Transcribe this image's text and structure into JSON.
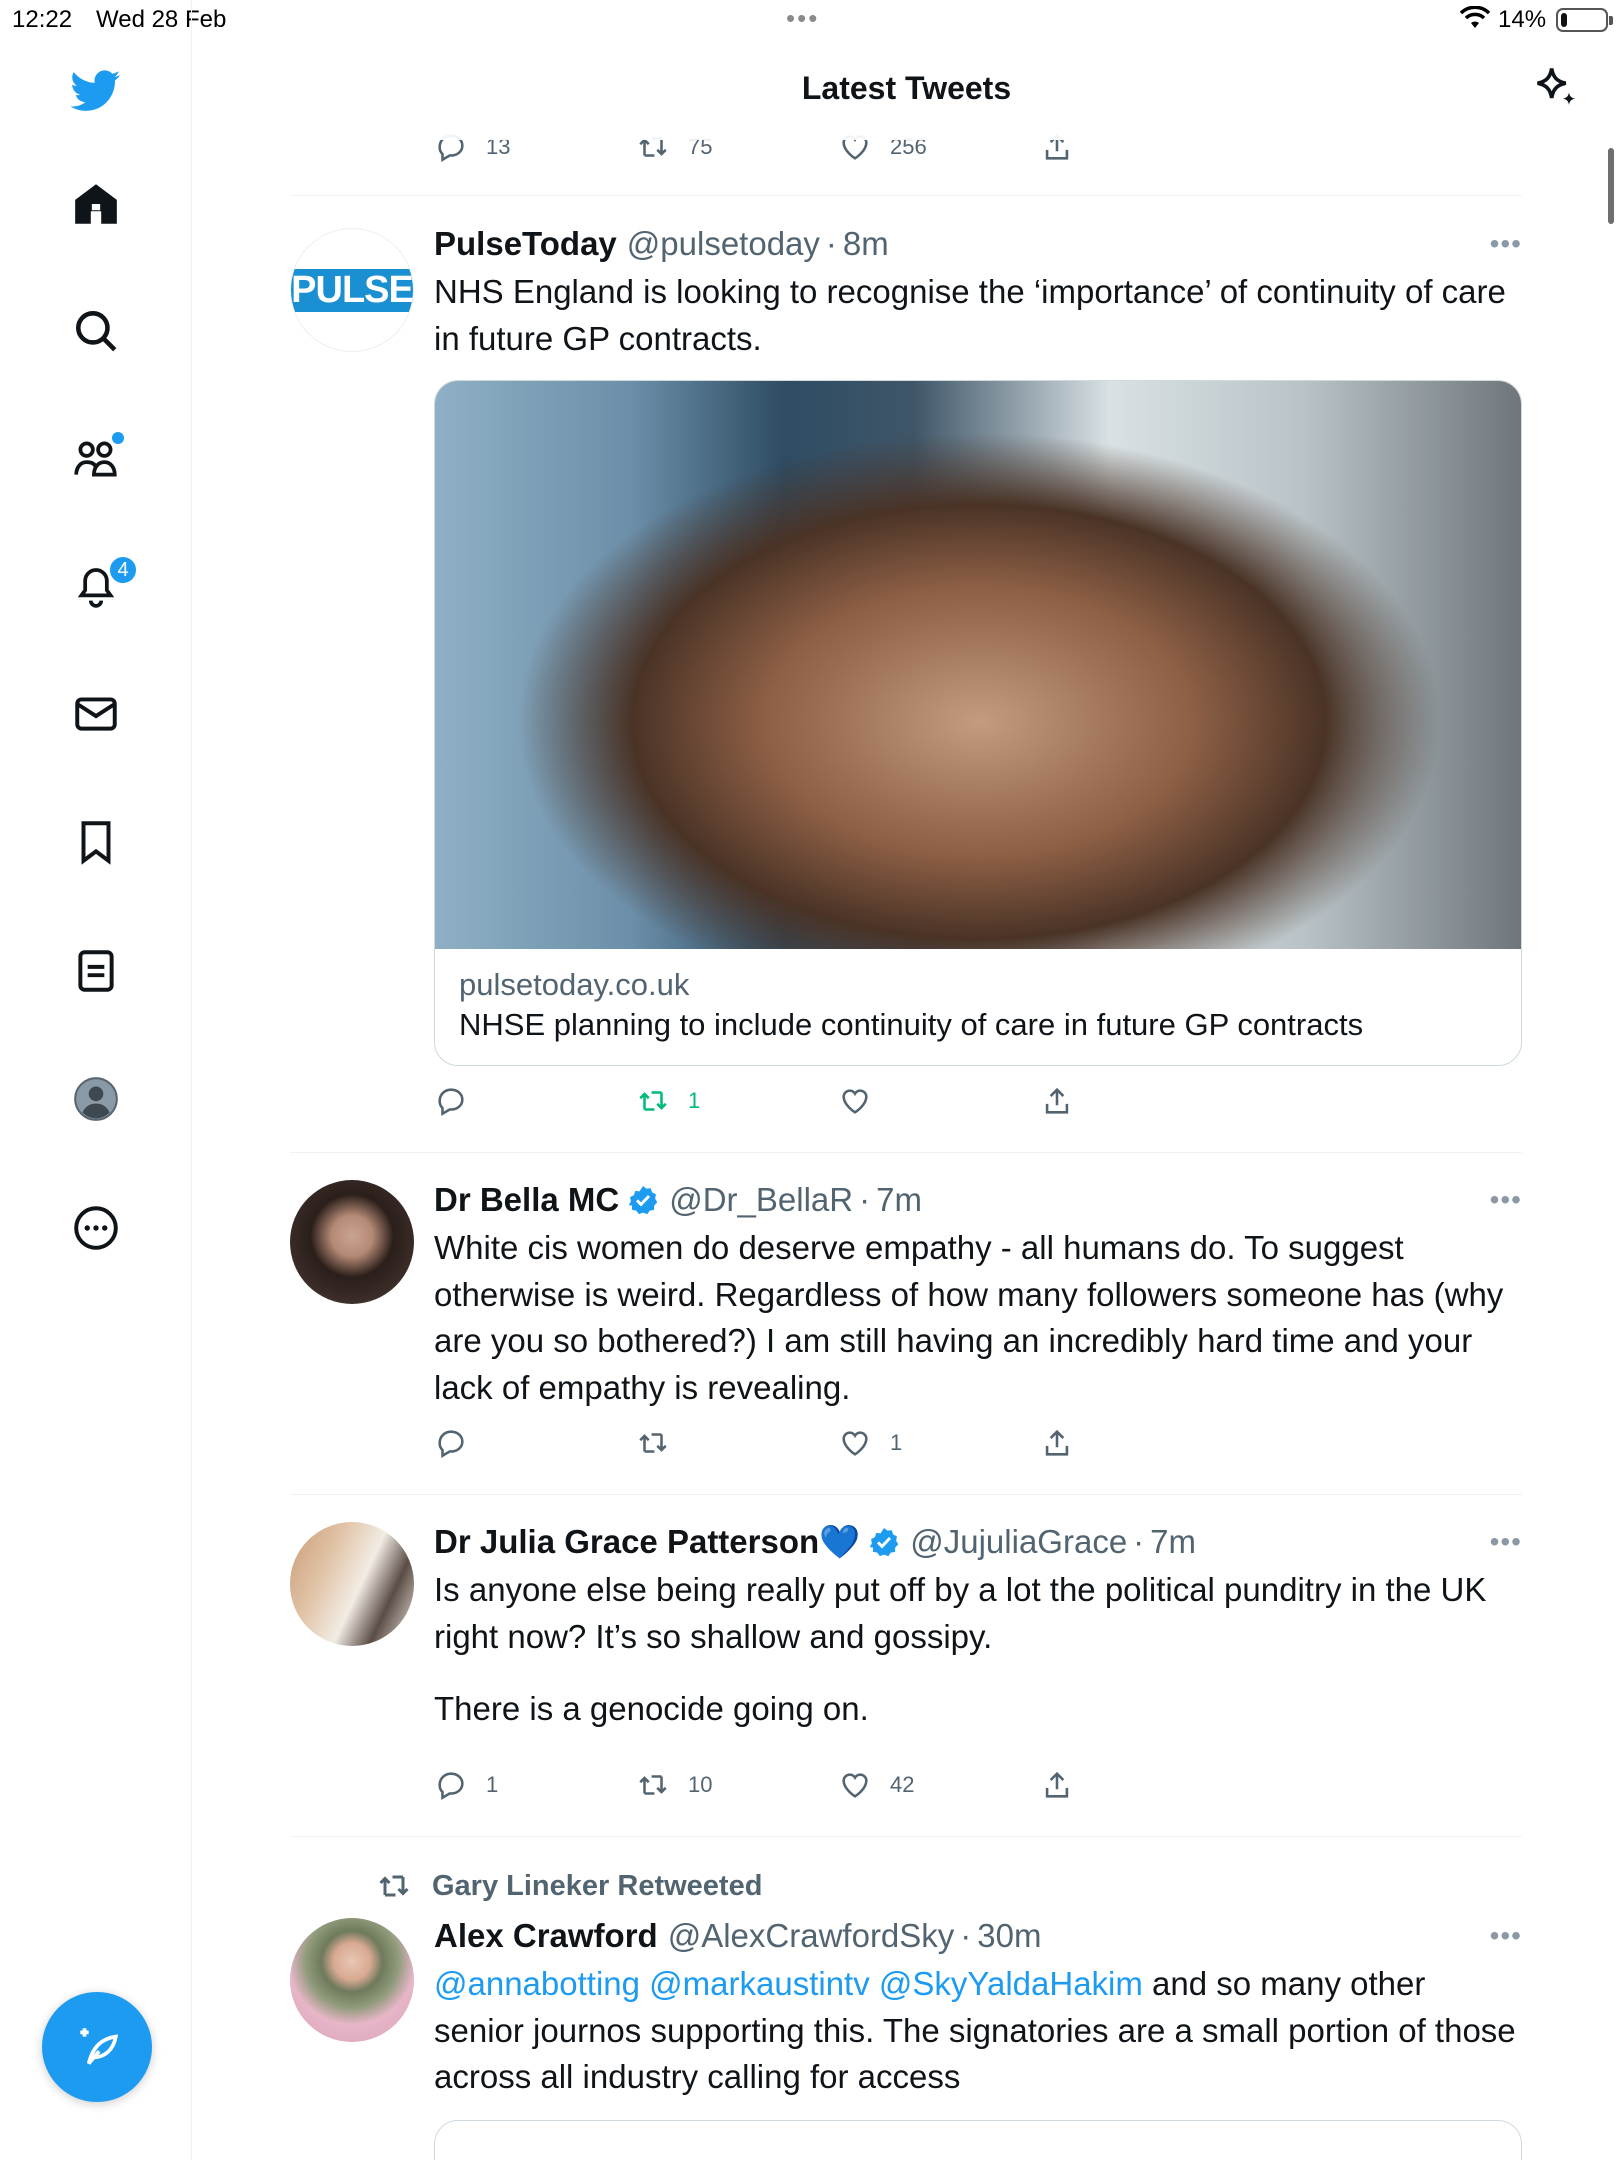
{
  "status_bar": {
    "time": "12:22",
    "date": "Wed 28 Feb",
    "battery_pct": "14%",
    "battery_level": 0.14
  },
  "header": {
    "title": "Latest Tweets"
  },
  "nav": {
    "notifications_badge": "4"
  },
  "colors": {
    "accent": "#1d9bf0",
    "retweet_active": "#00ba7c",
    "secondary_text": "#536471"
  },
  "top_actions": {
    "replies": "13",
    "retweets": "75",
    "likes": "256"
  },
  "tweets": [
    {
      "name": "PulseToday",
      "handle": "@pulsetoday",
      "time": "8m",
      "avatar_text": "PULSE",
      "text": "NHS England is looking to recognise the ‘importance’ of continuity of care in future GP contracts.",
      "card_domain": "pulsetoday.co.uk",
      "card_title": "NHSE planning to include continuity of care in future GP contracts",
      "replies": "",
      "retweets": "1",
      "likes": ""
    },
    {
      "name": "Dr Bella MC",
      "handle": "@Dr_BellaR",
      "time": "7m",
      "text": "White cis women do deserve empathy - all humans do. To suggest otherwise is weird. Regardless of how many followers someone has (why are you so bothered?) I am still having an incredibly hard time and your lack of empathy is revealing.",
      "replies": "",
      "retweets": "",
      "likes": "1"
    },
    {
      "name": "Dr Julia Grace Patterson💙",
      "handle": "@JujuliaGrace",
      "time": "7m",
      "text_line1": "Is anyone else being really put off by a lot the political punditry in the UK right now? It’s so shallow and gossipy.",
      "text_line2": "There is a genocide going on.",
      "replies": "1",
      "retweets": "10",
      "likes": "42"
    },
    {
      "retweeted_by": "Gary Lineker Retweeted",
      "name": "Alex Crawford",
      "handle": "@AlexCrawfordSky",
      "time": "30m",
      "mention1": "@annabotting",
      "mention2": "@markaustintv",
      "mention3": "@SkyYaldaHakim",
      "text_rest": " and so many other senior journos supporting this. The signatories are a small portion of those across all industry calling for access"
    }
  ]
}
